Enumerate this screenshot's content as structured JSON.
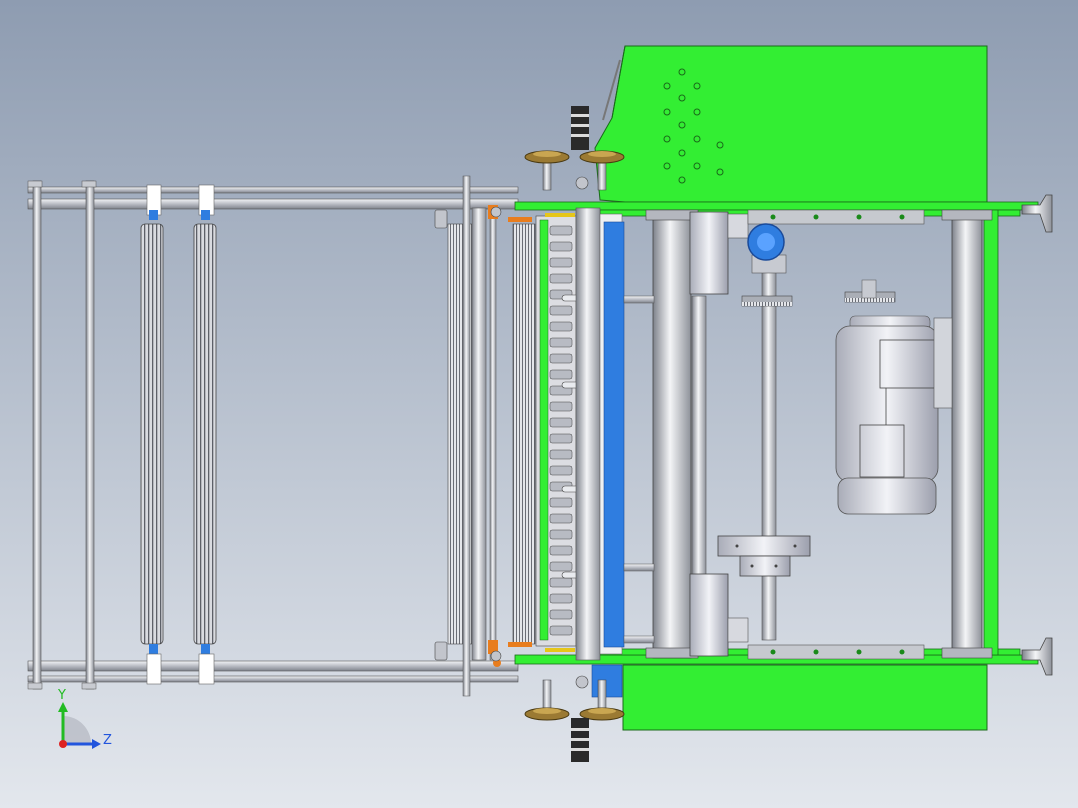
{
  "viewport": {
    "background_top": "#8e9cb1",
    "background_bottom": "#e3e7ed"
  },
  "model": {
    "green_housing_color": "#33ee33",
    "green_outline_color": "#1a6a1a",
    "blue_plate_color": "#2f7de0",
    "metal_color": "#c9ccd3",
    "metal_dark_color": "#7b7f88",
    "bronze_color": "#8a6a2a",
    "orange_accent": "#e87d1e",
    "yellow_accent": "#e6c619"
  },
  "triad": {
    "y_label": "Y",
    "z_label": "Z",
    "y_color": "#22bb22",
    "z_color": "#2255dd",
    "x_color": "#dd2222"
  }
}
